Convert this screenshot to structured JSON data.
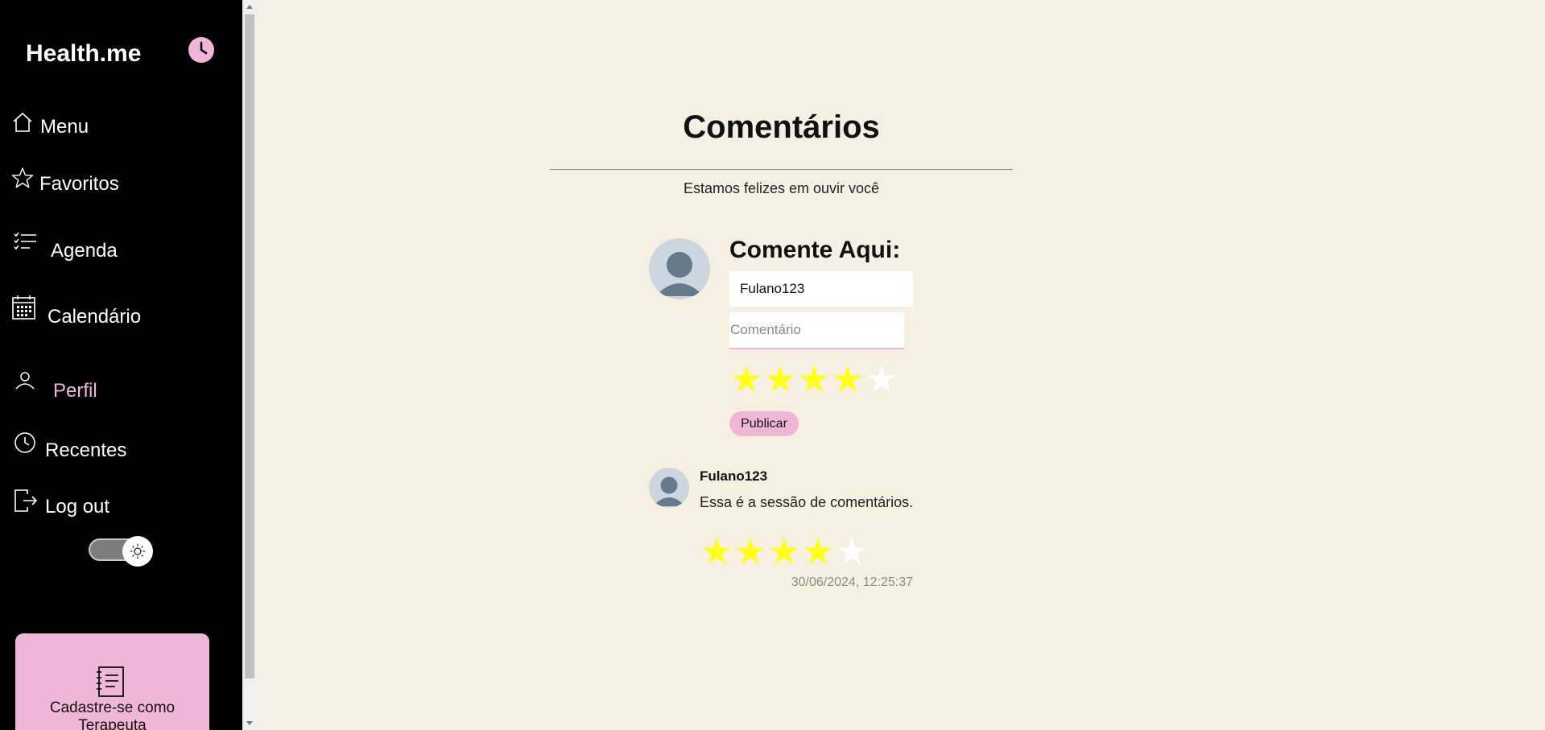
{
  "sidebar": {
    "brand": "Health.me",
    "badge_icon": "clock-icon",
    "items": [
      {
        "label": "Menu",
        "icon": "home-icon",
        "active": false
      },
      {
        "label": "Favoritos",
        "icon": "star-icon",
        "active": false
      },
      {
        "label": "Agenda",
        "icon": "checklist-icon",
        "active": false
      },
      {
        "label": "Calendário",
        "icon": "calendar-icon",
        "active": false
      },
      {
        "label": "Perfil",
        "icon": "user-icon",
        "active": true
      },
      {
        "label": "Recentes",
        "icon": "clock-icon",
        "active": false
      },
      {
        "label": "Log out",
        "icon": "logout-icon",
        "active": false
      }
    ],
    "theme_toggle_icon": "sun-icon",
    "cta": {
      "label": "Cadastre-se como Terapeuta",
      "icon": "notebook-icon"
    }
  },
  "main": {
    "title": "Comentários",
    "subtitle": "Estamos felizes em ouvir você",
    "form": {
      "heading": "Comente Aqui:",
      "name_value": "Fulano123",
      "comment_placeholder": "Comentário",
      "rating": 4,
      "max_rating": 5,
      "publish_label": "Publicar"
    },
    "comments": [
      {
        "author": "Fulano123",
        "text": "Essa é a sessão de comentários.",
        "rating": 4,
        "max_rating": 5,
        "timestamp": "30/06/2024, 12:25:37"
      }
    ]
  },
  "colors": {
    "accent": "#f0b6d8",
    "background": "#f5f0e2",
    "sidebar": "#000000",
    "star": "#ffff1a"
  }
}
